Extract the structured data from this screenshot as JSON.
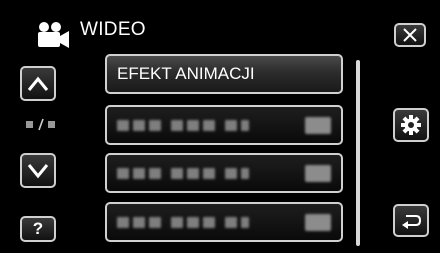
{
  "header": {
    "title": "WIDEO",
    "mode_icon": "video-camera-icon"
  },
  "nav": {
    "up_icon": "chevron-up-icon",
    "down_icon": "chevron-down-icon",
    "help_label": "?",
    "page_indicator": "▪/▪"
  },
  "menu": {
    "items": [
      {
        "label": "EFEKT ANIMACJI",
        "selected": true
      },
      {
        "label": "",
        "blurred": true
      },
      {
        "label": "",
        "blurred": true
      },
      {
        "label": "",
        "blurred": true
      }
    ]
  },
  "side_buttons": {
    "close_icon": "close-icon",
    "settings_icon": "gear-icon",
    "back_icon": "return-arrow-icon"
  },
  "colors": {
    "background": "#000000",
    "border": "#d0d0d0",
    "text": "#ffffff"
  }
}
